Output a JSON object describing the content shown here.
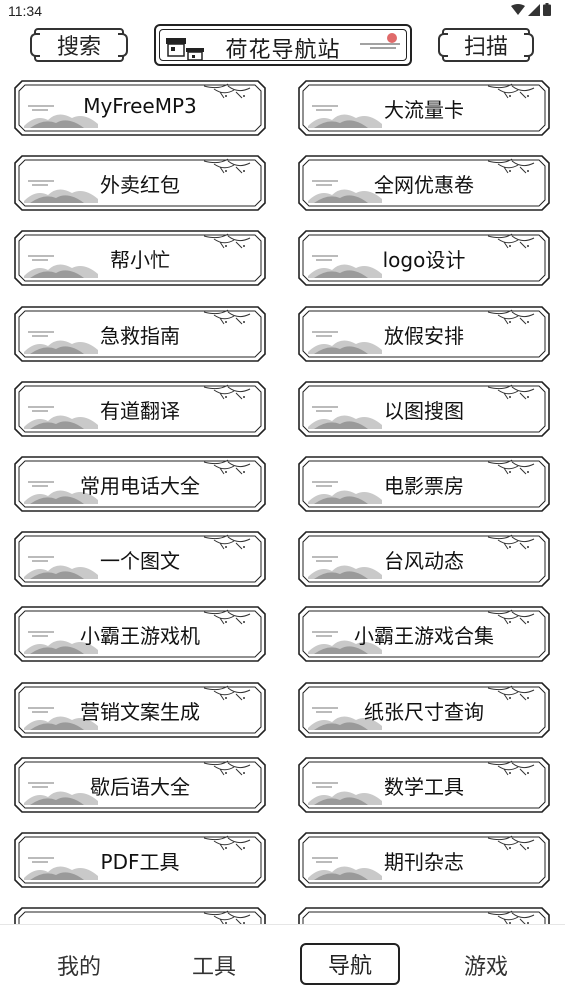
{
  "status": {
    "time": "11:34"
  },
  "header": {
    "search_label": "搜索",
    "title": "荷花导航站",
    "scan_label": "扫描"
  },
  "tools": [
    "MyFreeMP3",
    "大流量卡",
    "外卖红包",
    "全网优惠卷",
    "帮小忙",
    "logo设计",
    "急救指南",
    "放假安排",
    "有道翻译",
    "以图搜图",
    "常用电话大全",
    "电影票房",
    "一个图文",
    "台风动态",
    "小霸王游戏机",
    "小霸王游戏合集",
    "营销文案生成",
    "纸张尺寸查询",
    "歇后语大全",
    "数学工具",
    "PDF工具",
    "期刊杂志",
    "",
    ""
  ],
  "nav": {
    "mine": "我的",
    "tools": "工具",
    "navigation": "导航",
    "games": "游戏"
  }
}
